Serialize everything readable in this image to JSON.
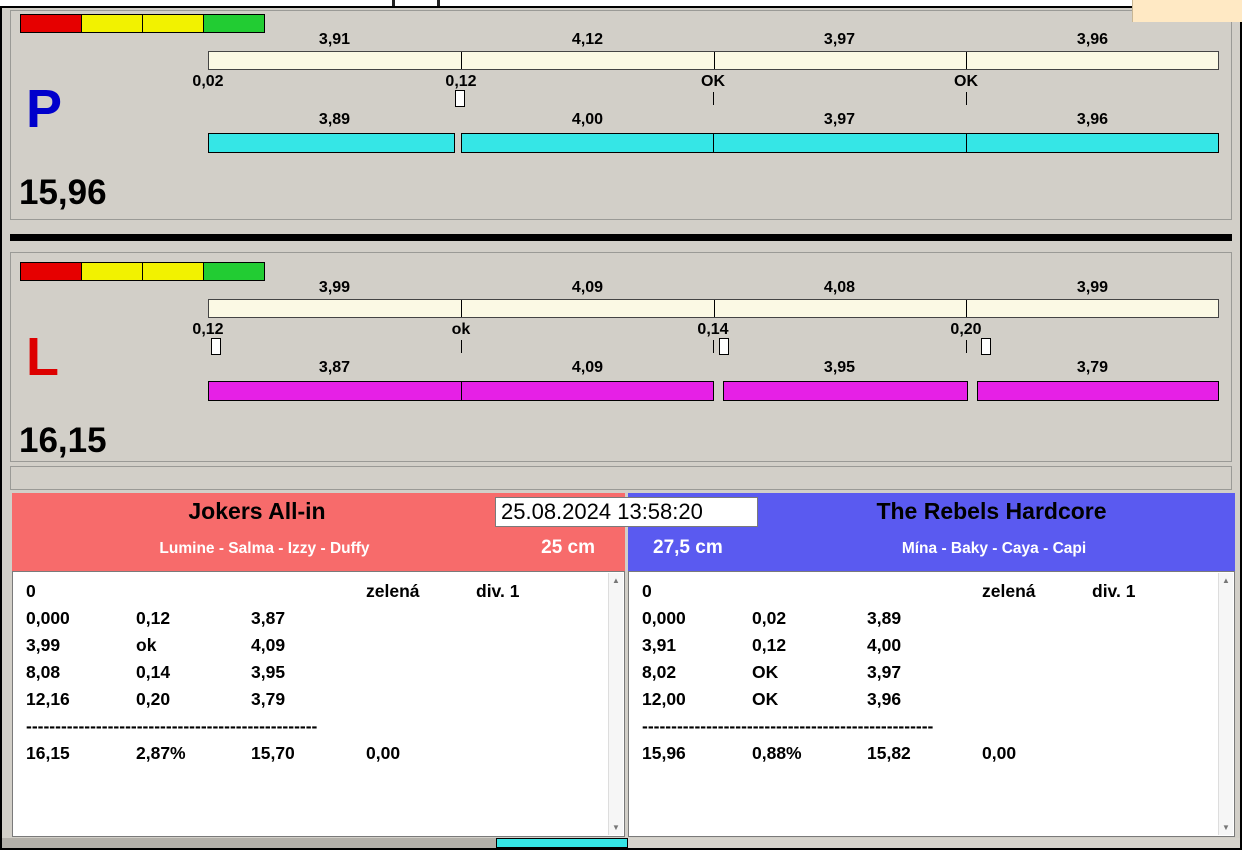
{
  "timestamp": "25.08.2024 13:58:20",
  "colors": {
    "light_red": "#e60000",
    "light_yellow": "#f2f200",
    "light_green": "#22cc33",
    "reference_bar": "#fbf9e4",
    "lane_p_bar": "#35e6e6",
    "lane_l_bar": "#e620e6"
  },
  "lanes": [
    {
      "letter": "P",
      "letter_color": "#0000cc",
      "total": "15,96",
      "top_segments": [
        "3,91",
        "4,12",
        "3,97",
        "3,96"
      ],
      "marks": [
        "0,02",
        "0,12",
        "OK",
        "OK"
      ],
      "bottom_segments": [
        "3,89",
        "4,00",
        "3,97",
        "3,96"
      ],
      "bar_color": "#35e6e6"
    },
    {
      "letter": "L",
      "letter_color": "#dd0000",
      "total": "16,15",
      "top_segments": [
        "3,99",
        "4,09",
        "4,08",
        "3,99"
      ],
      "marks": [
        "0,12",
        "ok",
        "0,14",
        "0,20"
      ],
      "bottom_segments": [
        "3,87",
        "4,09",
        "3,95",
        "3,79"
      ],
      "bar_color": "#e620e6"
    }
  ],
  "teams": [
    {
      "name": "Jokers All-in",
      "members": "Lumine - Salma - Izzy - Duffy",
      "jump_height": "25 cm",
      "header_color": "#f76b6b",
      "rows": [
        [
          "0",
          "",
          "",
          "zelená",
          "div. 1"
        ],
        [
          "0,000",
          "0,12",
          "3,87",
          "",
          ""
        ],
        [
          "3,99",
          "ok",
          "4,09",
          "",
          ""
        ],
        [
          "8,08",
          "0,14",
          "3,95",
          "",
          ""
        ],
        [
          "12,16",
          "0,20",
          "3,79",
          "",
          ""
        ],
        [
          "16,15",
          "2,87%",
          "15,70",
          "0,00",
          ""
        ]
      ],
      "separator": "--------------------------------------------------"
    },
    {
      "name": "The Rebels Hardcore",
      "members": "Mína - Baky - Caya - Capi",
      "jump_height": "27,5 cm",
      "header_color": "#5a5af0",
      "rows": [
        [
          "0",
          "",
          "",
          "zelená",
          "div. 1"
        ],
        [
          "0,000",
          "0,02",
          "3,89",
          "",
          ""
        ],
        [
          "3,91",
          "0,12",
          "4,00",
          "",
          ""
        ],
        [
          "8,02",
          "OK",
          "3,97",
          "",
          ""
        ],
        [
          "12,00",
          "OK",
          "3,96",
          "",
          ""
        ],
        [
          "15,96",
          "0,88%",
          "15,82",
          "0,00",
          ""
        ]
      ],
      "separator": "--------------------------------------------------"
    }
  ],
  "scrollbar": {
    "up": "▲",
    "down": "▼"
  }
}
